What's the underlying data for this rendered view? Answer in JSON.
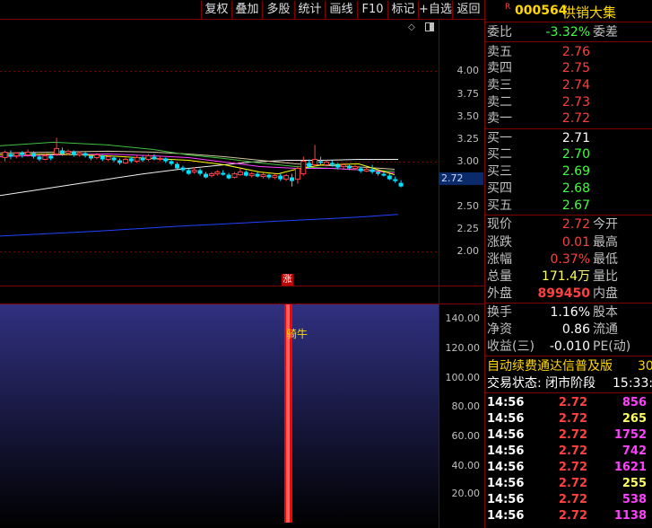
{
  "toolbar": {
    "buttons": [
      "复权",
      "叠加",
      "多股",
      "统计",
      "画线",
      "F10",
      "标记",
      "+自选",
      "返回"
    ]
  },
  "chart": {
    "price_axis_labels": [
      "4.00",
      "3.75",
      "3.50",
      "3.25",
      "3.00",
      "2.50",
      "2.25",
      "2.00"
    ],
    "current_price_tag": "2.72",
    "zhang_marker": "涨",
    "indicator_axis_labels": [
      "140.00",
      "120.00",
      "100.00",
      "80.00",
      "60.00",
      "40.00",
      "20.00"
    ],
    "indicator_label": "骑牛",
    "colors": {
      "up_candle": "#ff4040",
      "down_candle": "#00e0ff",
      "ma_white": "#f0f0f0",
      "ma_yellow": "#ffff00",
      "ma_magenta": "#ff40ff",
      "ma_green": "#40c040",
      "ma_beige": "#d0c8a0",
      "ma_blue": "#2040ff",
      "indicator_bg_top": "#303080",
      "indicator_bar": "#ff0000"
    }
  },
  "chart_data": {
    "type": "candlestick",
    "candles": [
      [
        3.04,
        3.1,
        3.12,
        3.0
      ],
      [
        3.08,
        3.05,
        3.12,
        3.02
      ],
      [
        3.06,
        3.09,
        3.1,
        3.03
      ],
      [
        3.09,
        3.07,
        3.11,
        3.04
      ],
      [
        3.07,
        3.1,
        3.13,
        3.05
      ],
      [
        3.09,
        3.05,
        3.11,
        3.03
      ],
      [
        3.05,
        3.02,
        3.07,
        3.0
      ],
      [
        3.02,
        3.06,
        3.08,
        3.01
      ],
      [
        3.06,
        3.03,
        3.08,
        3.01
      ],
      [
        3.08,
        3.14,
        3.26,
        3.06
      ],
      [
        3.12,
        3.08,
        3.15,
        3.06
      ],
      [
        3.09,
        3.11,
        3.13,
        3.07
      ],
      [
        3.1,
        3.07,
        3.12,
        3.05
      ],
      [
        3.07,
        3.09,
        3.11,
        3.05
      ],
      [
        3.09,
        3.06,
        3.1,
        3.04
      ],
      [
        3.06,
        3.03,
        3.08,
        3.01
      ],
      [
        3.04,
        3.07,
        3.09,
        3.02
      ],
      [
        3.06,
        3.02,
        3.07,
        3.0
      ],
      [
        3.02,
        3.05,
        3.06,
        3.0
      ],
      [
        3.04,
        3.01,
        3.06,
        2.99
      ],
      [
        3.01,
        2.98,
        3.03,
        2.96
      ],
      [
        2.98,
        3.02,
        3.04,
        2.97
      ],
      [
        3.03,
        3.0,
        3.05,
        2.98
      ],
      [
        3.0,
        3.04,
        3.06,
        2.98
      ],
      [
        3.04,
        3.01,
        3.06,
        2.99
      ],
      [
        3.02,
        3.06,
        3.08,
        3.0
      ],
      [
        3.05,
        3.02,
        3.08,
        3.01
      ],
      [
        3.02,
        3.03,
        3.05,
        3.0
      ],
      [
        3.03,
        3.0,
        3.04,
        2.98
      ],
      [
        3.0,
        2.97,
        3.02,
        2.95
      ],
      [
        2.97,
        2.92,
        2.99,
        2.91
      ],
      [
        2.93,
        2.9,
        2.95,
        2.88
      ],
      [
        2.9,
        2.86,
        2.92,
        2.85
      ],
      [
        2.88,
        2.9,
        2.93,
        2.86
      ],
      [
        2.9,
        2.86,
        2.92,
        2.84
      ],
      [
        2.86,
        2.82,
        2.88,
        2.81
      ],
      [
        2.84,
        2.86,
        2.88,
        2.82
      ],
      [
        2.86,
        2.88,
        2.9,
        2.84
      ],
      [
        2.87,
        2.85,
        2.9,
        2.84
      ],
      [
        2.85,
        2.81,
        2.87,
        2.8
      ],
      [
        2.82,
        2.86,
        2.88,
        2.81
      ],
      [
        2.85,
        2.88,
        2.92,
        2.84
      ],
      [
        2.88,
        2.84,
        2.9,
        2.83
      ],
      [
        2.84,
        2.86,
        2.88,
        2.82
      ],
      [
        2.86,
        2.83,
        2.88,
        2.82
      ],
      [
        2.83,
        2.85,
        2.87,
        2.81
      ],
      [
        2.85,
        2.82,
        2.86,
        2.8
      ],
      [
        2.82,
        2.84,
        2.86,
        2.8
      ],
      [
        2.84,
        2.8,
        2.86,
        2.78
      ],
      [
        2.8,
        2.84,
        2.86,
        2.78
      ],
      [
        2.82,
        2.78,
        2.86,
        2.72
      ],
      [
        2.8,
        2.92,
        2.95,
        2.75
      ],
      [
        2.86,
        3.0,
        3.05,
        2.84
      ],
      [
        2.98,
        2.94,
        3.02,
        2.92
      ],
      [
        2.96,
        3.02,
        3.18,
        2.94
      ],
      [
        3.0,
        2.98,
        3.05,
        2.96
      ],
      [
        2.96,
        2.99,
        3.01,
        2.94
      ],
      [
        2.98,
        2.96,
        3.01,
        2.94
      ],
      [
        2.96,
        2.93,
        2.98,
        2.91
      ],
      [
        2.94,
        2.96,
        2.98,
        2.92
      ],
      [
        2.95,
        2.92,
        2.97,
        2.9
      ],
      [
        2.92,
        2.94,
        2.96,
        2.9
      ],
      [
        2.92,
        2.89,
        2.94,
        2.87
      ],
      [
        2.89,
        2.91,
        2.93,
        2.88
      ],
      [
        2.91,
        2.88,
        2.96,
        2.86
      ],
      [
        2.88,
        2.86,
        2.9,
        2.84
      ],
      [
        2.86,
        2.84,
        2.88,
        2.83
      ],
      [
        2.84,
        2.8,
        2.86,
        2.79
      ],
      [
        2.8,
        2.78,
        2.83,
        2.76
      ],
      [
        2.76,
        2.72,
        2.79,
        2.71
      ]
    ],
    "ma_white": [
      [
        0,
        2.62
      ],
      [
        40,
        2.68
      ],
      [
        80,
        2.74
      ],
      [
        120,
        2.8
      ],
      [
        160,
        2.86
      ],
      [
        200,
        2.91
      ],
      [
        240,
        2.95
      ],
      [
        280,
        2.99
      ],
      [
        320,
        3.01
      ],
      [
        360,
        3.01
      ],
      [
        400,
        3.02
      ],
      [
        444,
        3.02
      ]
    ],
    "ma_yellow": [
      [
        0,
        3.07
      ],
      [
        60,
        3.08
      ],
      [
        120,
        3.06
      ],
      [
        170,
        3.03
      ],
      [
        210,
        3.01
      ],
      [
        250,
        2.96
      ],
      [
        290,
        2.88
      ],
      [
        310,
        2.86
      ],
      [
        330,
        2.91
      ],
      [
        360,
        2.96
      ],
      [
        400,
        2.97
      ],
      [
        440,
        2.85
      ]
    ],
    "ma_magenta": [
      [
        0,
        3.05
      ],
      [
        60,
        3.07
      ],
      [
        120,
        3.08
      ],
      [
        170,
        3.06
      ],
      [
        210,
        3.04
      ],
      [
        250,
        2.99
      ],
      [
        290,
        2.94
      ],
      [
        330,
        2.92
      ],
      [
        370,
        2.92
      ],
      [
        410,
        2.9
      ],
      [
        440,
        2.87
      ]
    ],
    "ma_green": [
      [
        0,
        3.17
      ],
      [
        60,
        3.21
      ],
      [
        120,
        3.18
      ],
      [
        170,
        3.13
      ],
      [
        210,
        3.07
      ],
      [
        250,
        3.03
      ],
      [
        290,
        2.98
      ],
      [
        330,
        2.94
      ],
      [
        370,
        2.92
      ],
      [
        410,
        2.9
      ],
      [
        440,
        2.89
      ]
    ],
    "ma_beige": [
      [
        0,
        3.09
      ],
      [
        60,
        3.1
      ],
      [
        120,
        3.11
      ],
      [
        170,
        3.1
      ],
      [
        210,
        3.08
      ],
      [
        250,
        3.05
      ],
      [
        290,
        3.01
      ],
      [
        330,
        2.97
      ],
      [
        370,
        2.95
      ],
      [
        410,
        2.93
      ],
      [
        440,
        2.91
      ]
    ],
    "ma_blue": [
      [
        0,
        2.17
      ],
      [
        100,
        2.22
      ],
      [
        200,
        2.28
      ],
      [
        300,
        2.33
      ],
      [
        400,
        2.38
      ],
      [
        444,
        2.41
      ]
    ],
    "price_ylim": [
      2.0,
      4.0
    ],
    "indicator": {
      "ylim": [
        0,
        150
      ],
      "bar_index": 53,
      "value": 150
    }
  },
  "panel": {
    "r_mark": "R",
    "code": "000564",
    "name": "供销大集",
    "weibi_label": "委比",
    "weibi_value": "-3.32%",
    "weicha_label": "委差",
    "asks": [
      {
        "label": "卖五",
        "price": "2.76"
      },
      {
        "label": "卖四",
        "price": "2.75"
      },
      {
        "label": "卖三",
        "price": "2.74"
      },
      {
        "label": "卖二",
        "price": "2.73"
      },
      {
        "label": "卖一",
        "price": "2.72"
      }
    ],
    "bids": [
      {
        "label": "买一",
        "price": "2.71"
      },
      {
        "label": "买二",
        "price": "2.70"
      },
      {
        "label": "买三",
        "price": "2.69"
      },
      {
        "label": "买四",
        "price": "2.68"
      },
      {
        "label": "买五",
        "price": "2.67"
      }
    ],
    "stats1": [
      {
        "label": "现价",
        "value": "2.72",
        "label2": "今开"
      },
      {
        "label": "涨跌",
        "value": "0.01",
        "label2": "最高"
      },
      {
        "label": "涨幅",
        "value": "0.37%",
        "label2": "最低"
      },
      {
        "label": "总量",
        "value": "171.4万",
        "label2": "量比"
      },
      {
        "label": "外盘",
        "value": "899450",
        "label2": "内盘"
      }
    ],
    "stats2": [
      {
        "label": "换手",
        "value": "1.16%",
        "label2": "股本"
      },
      {
        "label": "净资",
        "value": "0.86",
        "label2": "流通"
      },
      {
        "label": "收益(三)",
        "value": "-0.010",
        "label2": "PE(动)"
      }
    ],
    "promo_text": "自动续费通达信普及版",
    "promo_extra": "30",
    "status_text": "交易状态: 闭市阶段",
    "status_time": "15:33:3",
    "trades": [
      {
        "time": "14:56",
        "price": "2.72",
        "vol": "856"
      },
      {
        "time": "14:56",
        "price": "2.72",
        "vol": "265"
      },
      {
        "time": "14:56",
        "price": "2.72",
        "vol": "1752"
      },
      {
        "time": "14:56",
        "price": "2.72",
        "vol": "742"
      },
      {
        "time": "14:56",
        "price": "2.72",
        "vol": "1621"
      },
      {
        "time": "14:56",
        "price": "2.72",
        "vol": "255"
      },
      {
        "time": "14:56",
        "price": "2.72",
        "vol": "538"
      },
      {
        "time": "14:56",
        "price": "2.72",
        "vol": "1138"
      }
    ]
  }
}
